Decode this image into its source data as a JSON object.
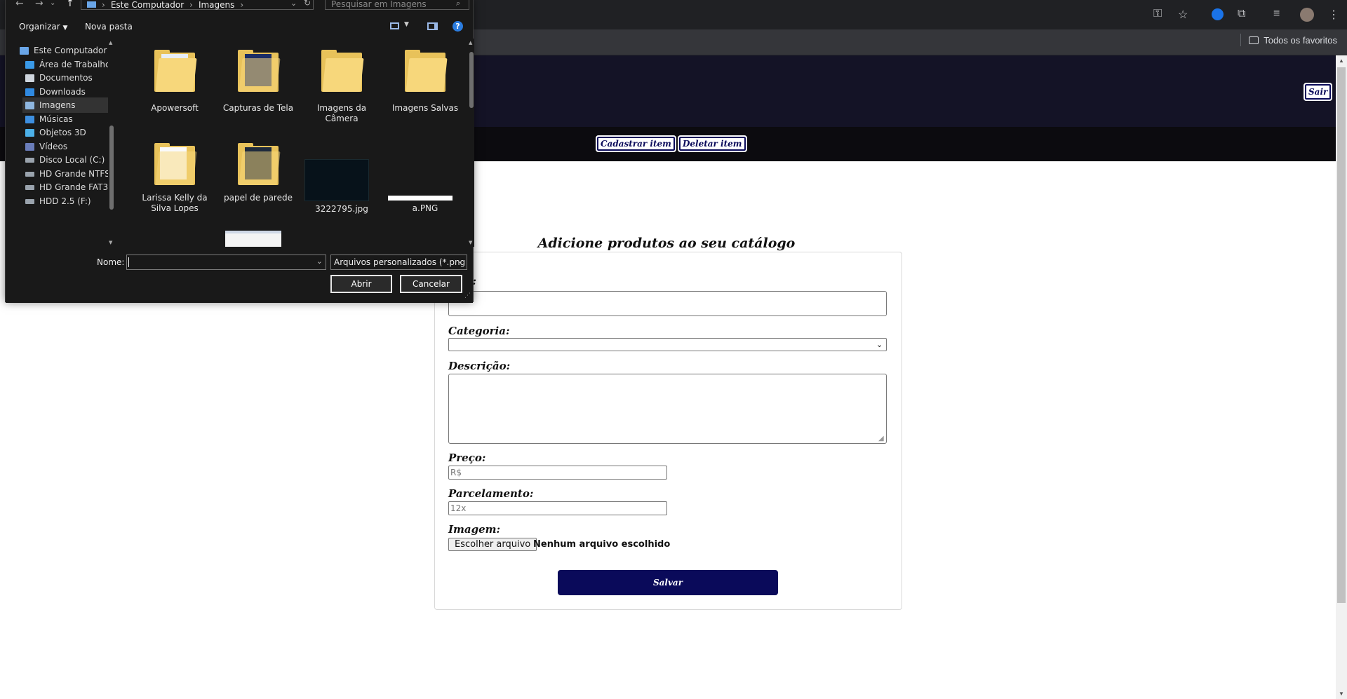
{
  "browser": {
    "bookmarks_label": "Todos os favoritos",
    "icons": [
      "key-icon",
      "star-icon",
      "extension-icon",
      "puzzle-icon",
      "media-icon",
      "profile-avatar",
      "menu-icon"
    ]
  },
  "header": {
    "logout_label": "Sair"
  },
  "nav": {
    "items": [
      "Cadastrar item",
      "Deletar item"
    ]
  },
  "form": {
    "title": "Adicione produtos ao seu catálogo",
    "name_label_visible": "e:",
    "category_label": "Categoria:",
    "description_label": "Descrição:",
    "price_label": "Preço:",
    "price_placeholder": "R$",
    "installments_label": "Parcelamento:",
    "installments_placeholder": "12x",
    "image_label": "Imagem:",
    "file_button": "Escolher arquivo",
    "file_status": "Nenhum arquivo escolhido",
    "save_label": "Salvar"
  },
  "dialog": {
    "breadcrumb": [
      "Este Computador",
      "Imagens"
    ],
    "search_placeholder": "Pesquisar em Imagens",
    "toolbar": {
      "organize": "Organizar",
      "new_folder": "Nova pasta"
    },
    "sidebar": [
      {
        "label": "Este Computador",
        "icon": "computer-icon"
      },
      {
        "label": "Área de Trabalhc",
        "icon": "desktop-icon"
      },
      {
        "label": "Documentos",
        "icon": "documents-icon"
      },
      {
        "label": "Downloads",
        "icon": "download-icon"
      },
      {
        "label": "Imagens",
        "icon": "pictures-icon",
        "selected": true
      },
      {
        "label": "Músicas",
        "icon": "music-icon"
      },
      {
        "label": "Objetos 3D",
        "icon": "objects-3d-icon"
      },
      {
        "label": "Vídeos",
        "icon": "videos-icon"
      },
      {
        "label": "Disco Local (C:)",
        "icon": "drive-icon"
      },
      {
        "label": "HD Grande NTFS",
        "icon": "drive-icon"
      },
      {
        "label": "HD Grande FAT3",
        "icon": "drive-icon"
      },
      {
        "label": "HDD 2.5 (F:)",
        "icon": "drive-icon"
      }
    ],
    "files": [
      {
        "name": "Apowersoft",
        "kind": "folder"
      },
      {
        "name": "Capturas de Tela",
        "kind": "folder"
      },
      {
        "name": "Imagens da Câmera",
        "kind": "folder"
      },
      {
        "name": "Imagens Salvas",
        "kind": "folder"
      },
      {
        "name": "Larissa Kelly da Silva Lopes",
        "kind": "folder"
      },
      {
        "name": "papel de parede",
        "kind": "folder"
      },
      {
        "name": "3222795.jpg",
        "kind": "image"
      },
      {
        "name": "a.PNG",
        "kind": "image"
      }
    ],
    "filename_label": "Nome:",
    "filename_value": "",
    "filetype": "Arquivos personalizados (*.png",
    "open_label": "Abrir",
    "cancel_label": "Cancelar"
  }
}
